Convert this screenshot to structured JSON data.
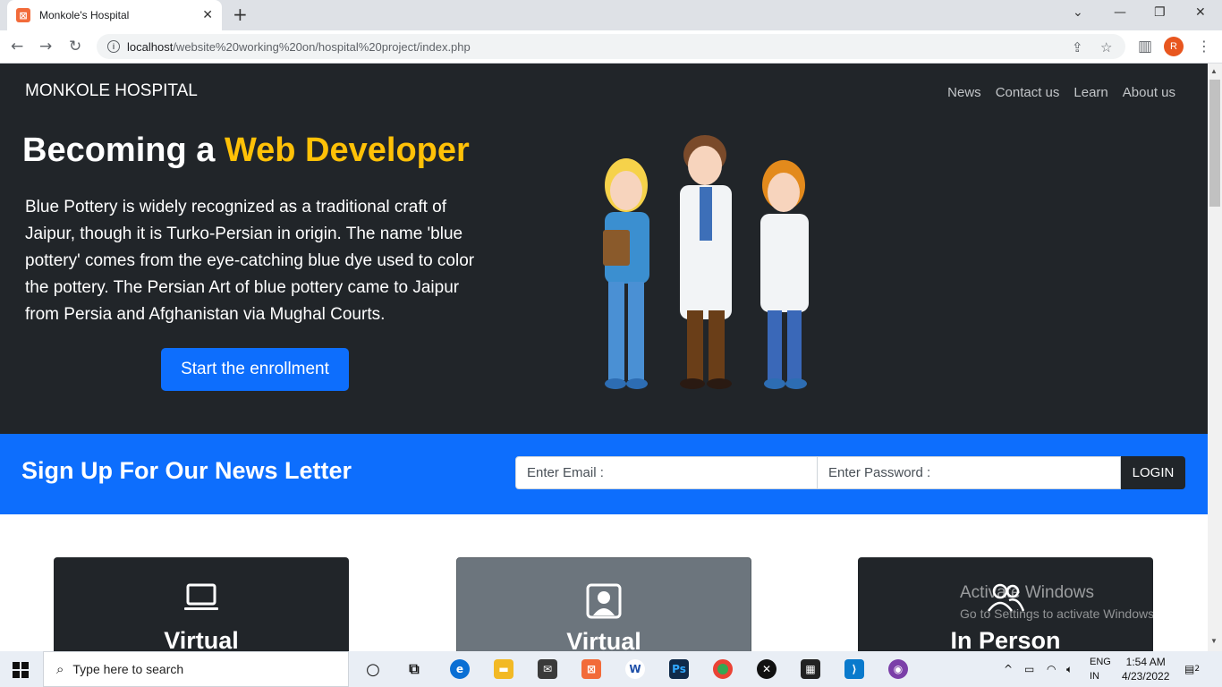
{
  "browser": {
    "tab_title": "Monkole's Hospital",
    "tab_close": "✕",
    "new_tab": "+",
    "url_host": "localhost",
    "url_path": "/website%20working%20on/hospital%20project/index.php",
    "profile_initial": "R"
  },
  "site": {
    "brand": "MONKOLE HOSPITAL",
    "nav": [
      "News",
      "Contact us",
      "Learn",
      "About us"
    ],
    "hero": {
      "title_prefix": "Becoming a ",
      "title_accent": "Web Developer",
      "text": "Blue Pottery is widely recognized as a traditional craft of Jaipur, though it is Turko-Persian in origin. The name 'blue pottery' comes from the eye-catching blue dye used to color the pottery. The Persian Art of blue pottery came to Jaipur from Persia and Afghanistan via Mughal Courts.",
      "cta_label": "Start the enrollment"
    },
    "newsletter": {
      "title": "Sign Up For Our News Letter",
      "email_placeholder": "Enter Email :",
      "password_placeholder": "Enter Password :",
      "button_label": "LOGIN"
    },
    "cards": [
      {
        "title": "Virtual",
        "icon": "laptop-icon"
      },
      {
        "title": "Virtual",
        "icon": "person-square-icon"
      },
      {
        "title": "In Person",
        "icon": "people-icon"
      }
    ]
  },
  "watermark": {
    "title": "Activate Windows",
    "subtitle": "Go to Settings to activate Windows."
  },
  "taskbar": {
    "search_placeholder": "Type here to search",
    "lang_top": "ENG",
    "lang_bottom": "IN",
    "time": "1:54 AM",
    "date": "4/23/2022",
    "notification_count": "2"
  },
  "colors": {
    "hero_bg": "#212529",
    "accent": "#ffc107",
    "primary": "#0d6efd",
    "card_gray": "#6c757d"
  }
}
